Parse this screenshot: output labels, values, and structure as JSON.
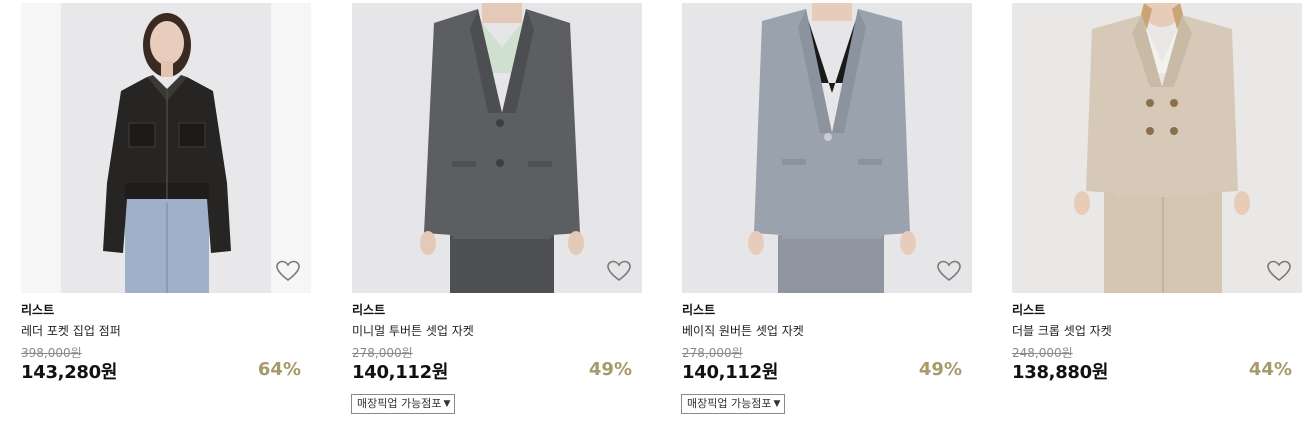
{
  "products": [
    {
      "brand": "리스트",
      "name": "레더 포켓 집업 점퍼",
      "original_price": "398,000원",
      "price": "143,280원",
      "discount": "64%",
      "store_pickup": null,
      "garment_color": "#2a2927"
    },
    {
      "brand": "리스트",
      "name": "미니멀 투버튼 셋업 자켓",
      "original_price": "278,000원",
      "price": "140,112원",
      "discount": "49%",
      "store_pickup": "매장픽업 가능점포",
      "garment_color": "#5d5e61"
    },
    {
      "brand": "리스트",
      "name": "베이직 원버튼 셋업 자켓",
      "original_price": "278,000원",
      "price": "140,112원",
      "discount": "49%",
      "store_pickup": "매장픽업 가능점포",
      "garment_color": "#9aa2ad"
    },
    {
      "brand": "리스트",
      "name": "더블 크롭 셋업 자켓",
      "original_price": "248,000원",
      "price": "138,880원",
      "discount": "44%",
      "store_pickup": null,
      "garment_color": "#d7c9b7"
    }
  ],
  "icons": {
    "wishlist": "heart-outline-icon",
    "dropdown": "caret-down-icon"
  },
  "colors": {
    "discount": "#a8996b",
    "strikethrough": "#8a8a8a",
    "photo_background": "#e7e7e7"
  }
}
